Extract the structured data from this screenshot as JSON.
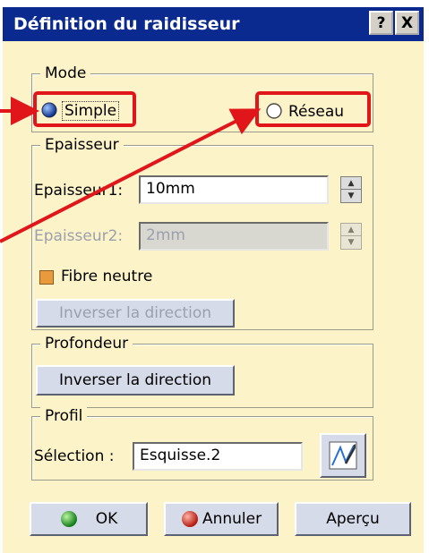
{
  "dialog": {
    "title": "Définition du raidisseur",
    "help_label": "?",
    "close_label": "X"
  },
  "mode": {
    "legend": "Mode",
    "option_simple": "Simple",
    "option_reseau": "Réseau",
    "selected": "Simple"
  },
  "epaisseur": {
    "legend": "Epaisseur",
    "field1_label": "Epaisseur1:",
    "field1_value": "10mm",
    "field2_label": "Epaisseur2:",
    "field2_value": "2mm",
    "fibre_label": "Fibre neutre",
    "fibre_checked": true,
    "invert_label": "Inverser la direction"
  },
  "profondeur": {
    "legend": "Profondeur",
    "invert_label": "Inverser la direction"
  },
  "profil": {
    "legend": "Profil",
    "selection_label": "Sélection :",
    "selection_value": "Esquisse.2"
  },
  "footer": {
    "ok_label": "OK",
    "cancel_label": "Annuler",
    "preview_label": "Aperçu"
  },
  "colors": {
    "titlebar": "#0b2a8f",
    "panel": "#fdf3c8",
    "annotation_red": "#e0161a",
    "annotation_arrow_blue": "#1537a0"
  }
}
